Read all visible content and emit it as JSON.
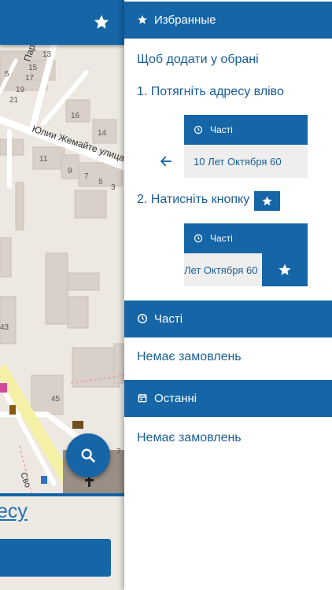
{
  "map": {
    "address_link_text": "есу",
    "street_label": "Юлии Жемайте улица",
    "street_label_2": "Пархо",
    "street_label_3": "Сво",
    "house_numbers": [
      "13",
      "5",
      "15",
      "17",
      "19",
      "21",
      "16",
      "14",
      "11",
      "9",
      "7",
      "5",
      "3",
      "43",
      "45",
      "7"
    ]
  },
  "drawer": {
    "favorites": {
      "title": "Избранные",
      "hint": "Щоб додати у обрані",
      "step1": "1. Потягніть адресу вліво",
      "step2": "2. Натисніть кнопку",
      "demo_card_title": "Часті",
      "demo_card_address": "10 Лет Октября 60",
      "demo_card2_address": "Лет Октября 60"
    },
    "frequent": {
      "title": "Часті",
      "empty": "Немає замовлень"
    },
    "recent": {
      "title": "Останні",
      "empty": "Немає замовлень"
    }
  },
  "colors": {
    "primary": "#1565a7",
    "text_blue": "#1a5d98",
    "card_bg": "#eeeeee"
  },
  "icons": {
    "favorites": "star-icon",
    "frequent": "clock-icon",
    "recent": "calendar-icon",
    "search": "search-icon",
    "back": "arrow-left-icon"
  }
}
